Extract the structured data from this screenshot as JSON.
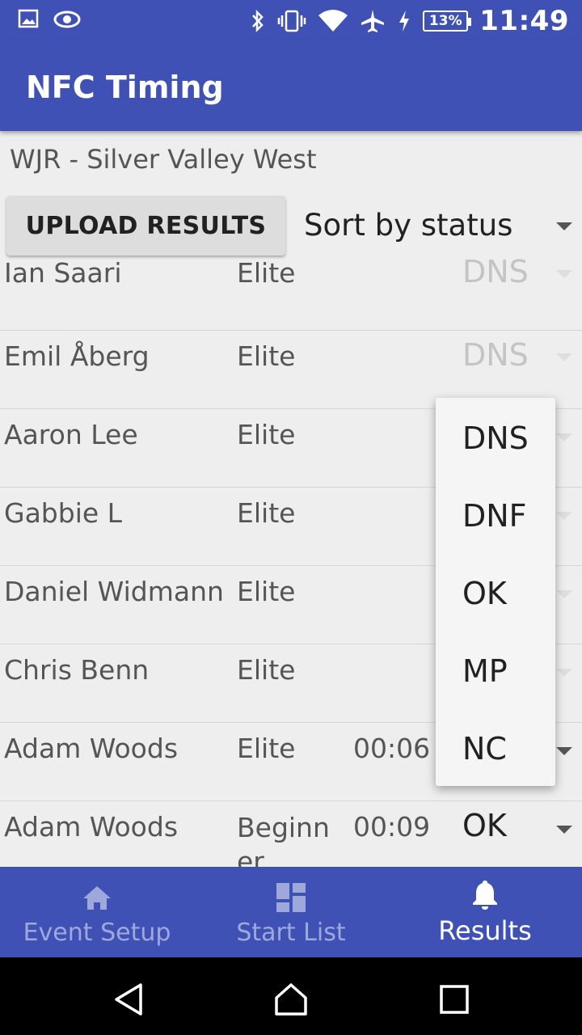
{
  "status_bar": {
    "battery": "13%",
    "time": "11:49",
    "icons": [
      "image-icon",
      "eye-icon",
      "bluetooth-icon",
      "vibrate-icon",
      "wifi-icon",
      "airplane-icon",
      "charging-icon",
      "battery-icon"
    ]
  },
  "appbar": {
    "title": "NFC Timing"
  },
  "event": {
    "name": "WJR - Silver Valley West"
  },
  "toolbar": {
    "upload_label": "UPLOAD RESULTS",
    "sort_selected": "Sort by status"
  },
  "results": [
    {
      "name": "Ian Saari",
      "class": "Elite",
      "time": "",
      "status": "DNS"
    },
    {
      "name": "Emil Åberg",
      "class": "Elite",
      "time": "",
      "status": "DNS"
    },
    {
      "name": "Aaron Lee",
      "class": "Elite",
      "time": "",
      "status": ""
    },
    {
      "name": "Gabbie L",
      "class": "Elite",
      "time": "",
      "status": ""
    },
    {
      "name": "Daniel Widmann",
      "class": "Elite",
      "time": "",
      "status": ""
    },
    {
      "name": "Chris Benn",
      "class": "Elite",
      "time": "",
      "status": ""
    },
    {
      "name": "Adam Woods",
      "class": "Elite",
      "time": "00:06",
      "status": ""
    },
    {
      "name": "Adam Woods",
      "class": "Beginner",
      "time": "00:09",
      "status": "OK"
    }
  ],
  "status_dropdown": {
    "options": [
      "DNS",
      "DNF",
      "OK",
      "MP",
      "NC"
    ]
  },
  "bottom_nav": {
    "tabs": [
      {
        "label": "Event Setup",
        "icon": "home-icon",
        "active": false
      },
      {
        "label": "Start List",
        "icon": "dashboard-icon",
        "active": false
      },
      {
        "label": "Results",
        "icon": "bell-icon",
        "active": true
      }
    ]
  },
  "colors": {
    "primary": "#3f51b5",
    "background": "#eeeeee",
    "inactive_tab": "#9fa8da"
  }
}
